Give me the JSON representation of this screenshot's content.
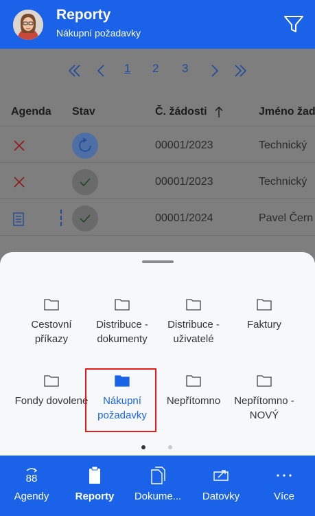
{
  "header": {
    "title": "Reporty",
    "subtitle": "Nákupní požadavky"
  },
  "pager": {
    "pages": [
      "1",
      "2",
      "3"
    ],
    "active_page": "1"
  },
  "table": {
    "columns": [
      "Agenda",
      "Stav",
      "Č. žádosti",
      "Jméno žad"
    ],
    "rows": [
      {
        "number": "00001/2023",
        "name": "Technický"
      },
      {
        "number": "00001/2023",
        "name": "Technický"
      },
      {
        "number": "00001/2024",
        "name": "Pavel Čern"
      }
    ]
  },
  "sheet": {
    "tiles": [
      {
        "label": "Cestovní příkazy"
      },
      {
        "label": "Distribuce - dokumenty"
      },
      {
        "label": "Distribuce - uživatelé"
      },
      {
        "label": "Faktury"
      },
      {
        "label": "Fondy dovolené"
      },
      {
        "label": "Nákupní požadavky"
      },
      {
        "label": "Nepřítomno"
      },
      {
        "label": "Nepřítomno - NOVÝ"
      }
    ],
    "page_count": 2,
    "active_page": 1
  },
  "nav": {
    "items": [
      {
        "label": "Agendy",
        "icon": "agendy-icon"
      },
      {
        "label": "Reporty",
        "icon": "clipboard-icon"
      },
      {
        "label": "Dokume...",
        "icon": "documents-icon"
      },
      {
        "label": "Datovky",
        "icon": "datovky-icon"
      },
      {
        "label": "Více",
        "icon": "more-icon"
      }
    ],
    "active": "Reporty"
  },
  "colors": {
    "brand_blue": "#1a63e8",
    "selection_red": "#e21c1c",
    "error_red": "#d32f2f"
  }
}
